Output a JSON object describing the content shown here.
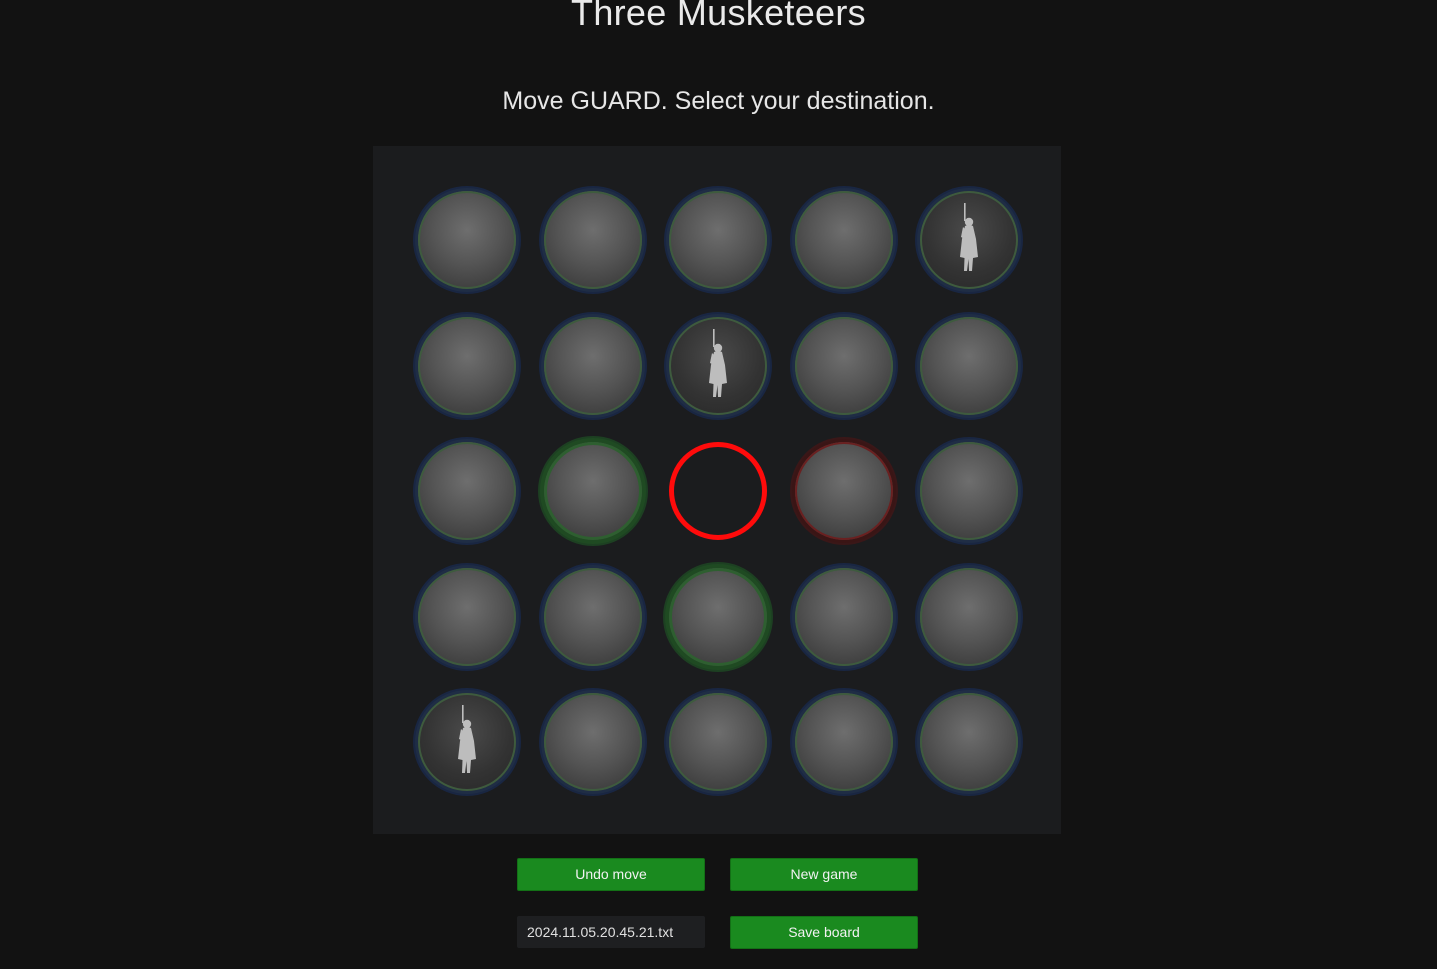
{
  "title": "Three Musketeers",
  "status": "Move GUARD. Select your destination.",
  "board": {
    "size": 5,
    "pieces": [
      {
        "row": 0,
        "col": 4,
        "type": "musketeer",
        "icon": "musketeer-icon"
      },
      {
        "row": 1,
        "col": 2,
        "type": "musketeer",
        "icon": "musketeer-icon"
      },
      {
        "row": 4,
        "col": 0,
        "type": "musketeer",
        "icon": "musketeer-icon"
      }
    ],
    "selected": {
      "row": 2,
      "col": 2
    },
    "highlight_green": [
      {
        "row": 2,
        "col": 1
      },
      {
        "row": 3,
        "col": 2
      }
    ],
    "highlight_red": [
      {
        "row": 2,
        "col": 3
      }
    ]
  },
  "controls": {
    "undo_label": "Undo move",
    "new_game_label": "New game",
    "save_label": "Save board",
    "filename_value": "2024.11.05.20.45.21.txt"
  },
  "colors": {
    "background": "#121212",
    "board": "#1b1c1e",
    "button": "#1a8a1f",
    "selected_ring": "#ff0b0b"
  }
}
